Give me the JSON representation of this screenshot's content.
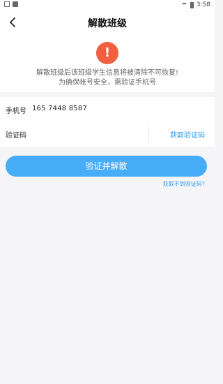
{
  "status_bar": {
    "time": "3:58",
    "icons": [
      "android-notification-icon",
      "sim-card-icon",
      "wifi-icon",
      "battery-icon"
    ]
  },
  "nav": {
    "back_icon": "chevron-left-icon",
    "title": "解散班级"
  },
  "warning": {
    "icon": "exclamation-icon",
    "icon_glyph": "!",
    "icon_color": "#f0603f",
    "line1": "解散班级后该班级学生信息将被清除不可恢复!",
    "line2": "为确保帐号安全，需验证手机号"
  },
  "form": {
    "phone_label": "手机号",
    "phone_value": "165 7448 8587",
    "code_label": "验证码",
    "code_value": "",
    "code_placeholder": "",
    "get_code_label": "获取验证码"
  },
  "actions": {
    "submit_label": "验证并解散",
    "submit_color": "#47adf8",
    "no_code_label": "获取不到验证码?"
  }
}
